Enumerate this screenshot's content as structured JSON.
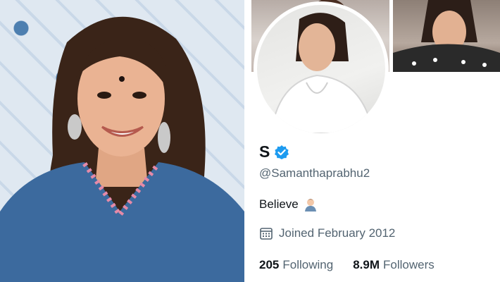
{
  "profile": {
    "display_name": "S",
    "handle": "@Samanthaprabhu2",
    "bio": "Believe",
    "joined": "Joined February 2012",
    "following_count": "205",
    "following_label": "Following",
    "followers_count": "8.9M",
    "followers_label": "Followers"
  },
  "icons": {
    "verified": "verified-badge-icon",
    "bio_emoji": "person-emoji-icon",
    "calendar": "calendar-icon"
  },
  "colors": {
    "accent": "#1d9bf0",
    "text_primary": "#0f1419",
    "text_secondary": "#536471",
    "dress_blue": "#3c6a9e"
  }
}
